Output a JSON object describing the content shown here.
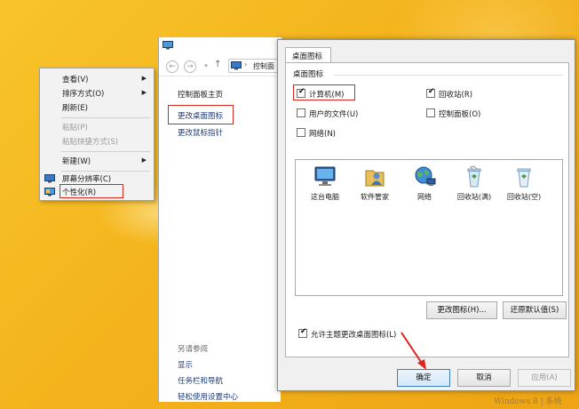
{
  "context_menu": {
    "items": [
      {
        "label": "查看(V)",
        "submenu": true,
        "disabled": false
      },
      {
        "label": "排序方式(O)",
        "submenu": true,
        "disabled": false
      },
      {
        "label": "刷新(E)",
        "submenu": false,
        "disabled": false
      },
      {
        "label": "粘贴(P)",
        "submenu": false,
        "disabled": true
      },
      {
        "label": "粘贴快捷方式(S)",
        "submenu": false,
        "disabled": true
      },
      {
        "label": "新建(W)",
        "submenu": true,
        "disabled": false
      },
      {
        "label": "屏幕分辨率(C)",
        "submenu": false,
        "disabled": false
      },
      {
        "label": "个性化(R)",
        "submenu": false,
        "disabled": false
      }
    ]
  },
  "control_panel": {
    "address_text": "控制面",
    "home_link": "控制面板主页",
    "links": [
      "更改桌面图标",
      "更改鼠标指针"
    ],
    "see_also_title": "另请参阅",
    "see_also": [
      "显示",
      "任务栏和导航",
      "轻松使用设置中心"
    ]
  },
  "dialog": {
    "tab_label": "桌面图标",
    "group_title": "桌面图标",
    "checkboxes": [
      {
        "label": "计算机(M)",
        "checked": true
      },
      {
        "label": "回收站(R)",
        "checked": true
      },
      {
        "label": "用户的文件(U)",
        "checked": false
      },
      {
        "label": "控制面板(O)",
        "checked": false
      },
      {
        "label": "网络(N)",
        "checked": false
      }
    ],
    "icons": [
      {
        "caption": "这台电脑",
        "icon": "computer-icon"
      },
      {
        "caption": "软件管家",
        "icon": "user-folder-icon"
      },
      {
        "caption": "网络",
        "icon": "network-globe-icon"
      },
      {
        "caption": "回收站(满)",
        "icon": "recycle-bin-full-icon"
      },
      {
        "caption": "回收站(空)",
        "icon": "recycle-bin-empty-icon"
      }
    ],
    "change_icon_button": "更改图标(H)...",
    "restore_default_button": "还原默认值(S)",
    "allow_themes_label": "允许主题更改桌面图标(L)",
    "allow_themes_checked": true,
    "ok_button": "确定",
    "cancel_button": "取消",
    "apply_button": "应用(A)"
  },
  "watermark": "Windows 8 | 系统",
  "colors": {
    "highlight": "#d9261c",
    "accent": "#f4b31c"
  }
}
